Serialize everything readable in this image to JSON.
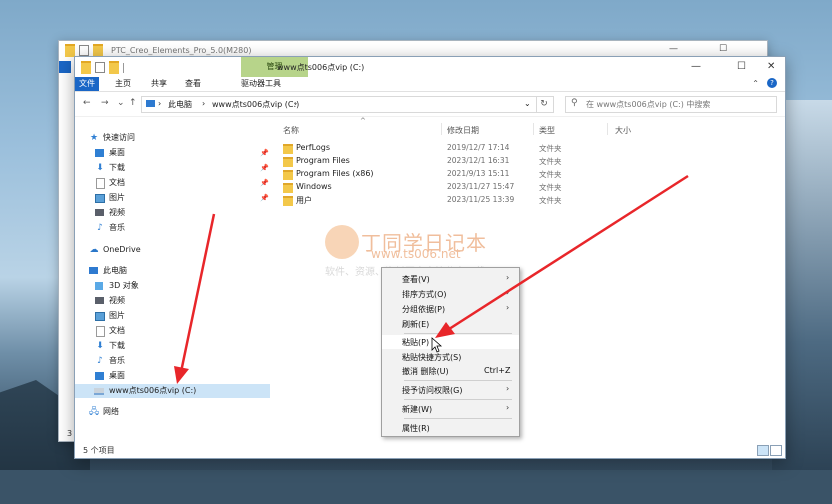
{
  "back_window": {
    "title": "PTC_Creo_Elements_Pro_5.0(M280)",
    "line_number": "3"
  },
  "window": {
    "title": "www点ts006点vip (C:)",
    "context_tab_group": "管理",
    "minimize": "—",
    "maximize": "☐",
    "close": "✕"
  },
  "ribbon": {
    "tabs": [
      "文件",
      "主页",
      "共享",
      "查看",
      "驱动器工具"
    ],
    "help": "?",
    "collapse": "⌃"
  },
  "address": {
    "back": "←",
    "forward": "→",
    "recent": "⌄",
    "up": "↑",
    "crumbs": [
      "此电脑",
      "www点ts006点vip (C:)"
    ],
    "separator": "›",
    "dropdown": "⌄",
    "refresh": "↻",
    "search_placeholder": "在 www点ts006点vip (C:) 中搜索",
    "search_icon": "⚲"
  },
  "nav_pane": {
    "quick_access": "快速访问",
    "quick_items": [
      "桌面",
      "下载",
      "文档",
      "图片",
      "视频",
      "音乐"
    ],
    "pin_icon": "📌",
    "onedrive": "OneDrive",
    "this_pc": "此电脑",
    "pc_items": [
      "3D 对象",
      "视频",
      "图片",
      "文档",
      "下载",
      "音乐",
      "桌面"
    ],
    "drive": "www点ts006点vip (C:)",
    "network": "网络"
  },
  "columns": {
    "name": "名称",
    "date": "修改日期",
    "type": "类型",
    "size": "大小",
    "sort_indicator": "^"
  },
  "files": [
    {
      "name": "PerfLogs",
      "date": "2019/12/7 17:14",
      "type": "文件夹"
    },
    {
      "name": "Program Files",
      "date": "2023/12/1 16:31",
      "type": "文件夹"
    },
    {
      "name": "Program Files (x86)",
      "date": "2021/9/13 15:11",
      "type": "文件夹"
    },
    {
      "name": "Windows",
      "date": "2023/11/27 15:47",
      "type": "文件夹"
    },
    {
      "name": "用户",
      "date": "2023/11/25 13:39",
      "type": "文件夹"
    }
  ],
  "status": {
    "item_count": "5 个项目"
  },
  "watermark": {
    "title": "丁同学日记本",
    "url": "www.ts006.net",
    "slogan": "软件、资源、资料网盘直接分享下载"
  },
  "context_menu": {
    "view": "查看(V)",
    "sort": "排序方式(O)",
    "group": "分组依据(P)",
    "refresh": "刷新(E)",
    "paste": "粘贴(P)",
    "paste_shortcut": "粘贴快捷方式(S)",
    "undo_delete": "撤消 删除(U)",
    "undo_key": "Ctrl+Z",
    "give_access": "授予访问权限(G)",
    "new": "新建(W)",
    "properties": "属性(R)",
    "submenu_arrow": "›"
  },
  "colors": {
    "accent": "#1a66c6",
    "manage_tab": "#b7d48a",
    "selection": "#cce4f7",
    "folder": "#f3c84a",
    "annotation_arrow": "#e8262a"
  }
}
